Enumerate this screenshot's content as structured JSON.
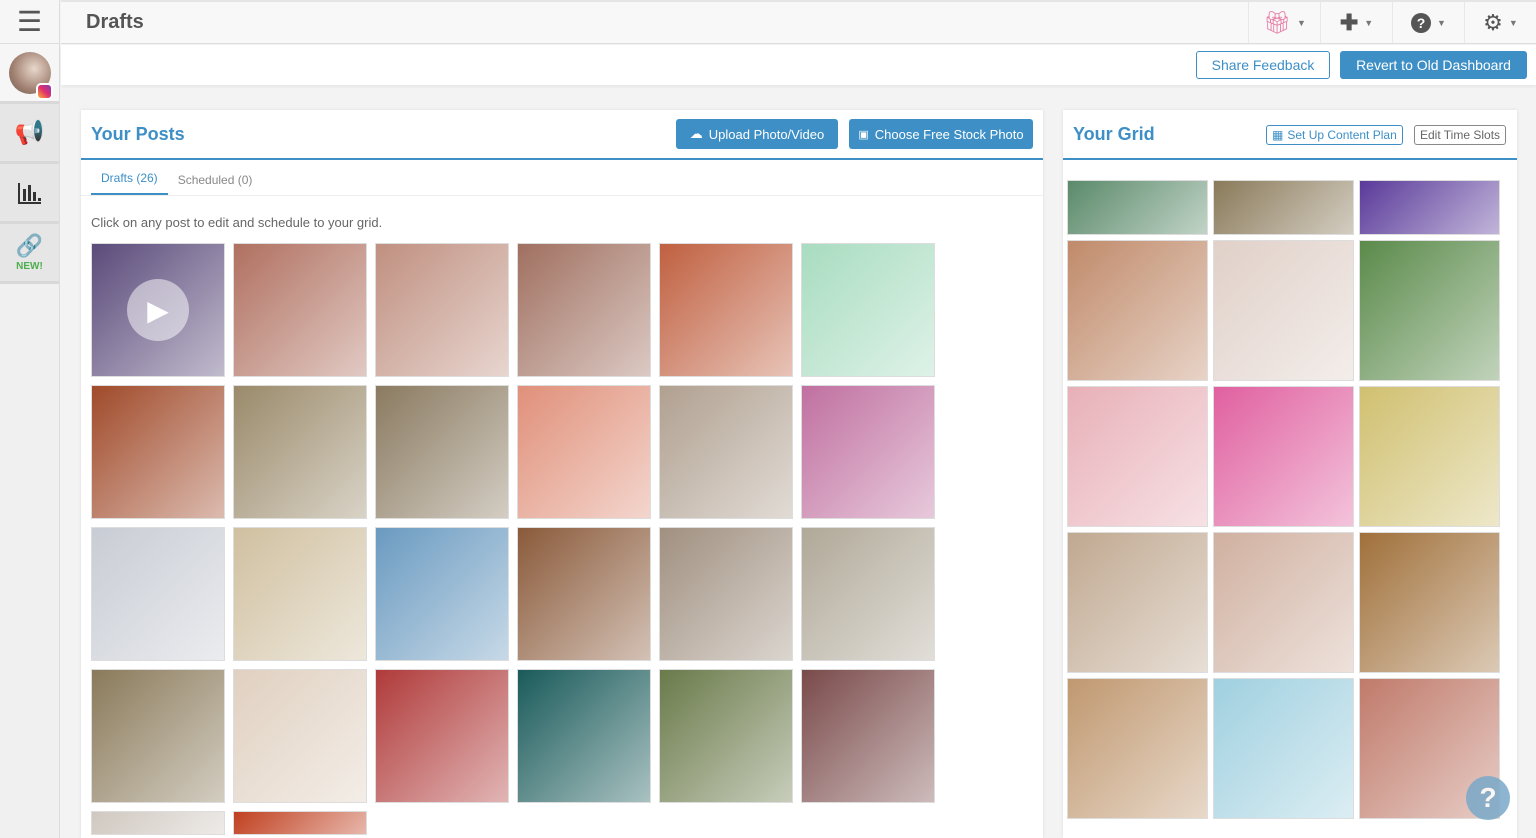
{
  "header": {
    "title": "Drafts",
    "share_feedback": "Share Feedback",
    "revert": "Revert to Old Dashboard"
  },
  "sidebar": {
    "new_badge": "NEW!"
  },
  "posts": {
    "title": "Your Posts",
    "upload": "Upload Photo/Video",
    "stock": "Choose Free Stock Photo",
    "tabs": [
      {
        "label": "Drafts (26)"
      },
      {
        "label": "Scheduled (0)"
      }
    ],
    "hint": "Click on any post to edit and schedule to your grid.",
    "tile_colors": [
      "#5a4a7a",
      "#b07060",
      "#c09080",
      "#a07060",
      "#c06040",
      "#a8dcc0",
      "#a04a2a",
      "#9a8a6a",
      "#8a7a60",
      "#e0907a",
      "#b0a090",
      "#c070a0",
      "#c8ccd4",
      "#d0c0a0",
      "#6a9ac0",
      "#8a5a3a",
      "#a09080",
      "#b0a898",
      "#8a7a5a",
      "#e0d0c0",
      "#b03a3a",
      "#1a5a5a",
      "#6a7a4a",
      "#7a4a4a",
      "#d0c8c0",
      "#c04020"
    ]
  },
  "grid": {
    "title": "Your Grid",
    "content_plan": "Set Up Content Plan",
    "edit_slots": "Edit Time Slots",
    "tile_colors": [
      "#5a8a6a",
      "#8a7a5a",
      "#5a3a9a",
      "#c08a6a",
      "#e0d0c8",
      "#5a8a4a",
      "#e8b0b8",
      "#e060a0",
      "#d0c070",
      "#c0a890",
      "#d0b0a0",
      "#a0703a",
      "#c09870",
      "#a0d0e0",
      "#c07a6a"
    ]
  }
}
